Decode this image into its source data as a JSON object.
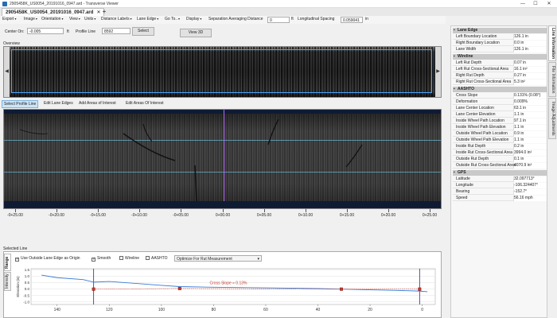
{
  "window": {
    "title": "2905458K_US0054_20191016_0947.ard - Transverse Viewer",
    "controls": [
      "—",
      "☐",
      "✕"
    ]
  },
  "tabs": [
    {
      "label": "2905458K_US0054_20191016_0947.ard",
      "close": "✕"
    }
  ],
  "tab_add": "+",
  "menu": {
    "items": [
      "Export",
      "Image",
      "Orientation",
      "View",
      "Units",
      "Distance Labels",
      "Lane Edge",
      "Go To..",
      "Display"
    ],
    "sep_avg_label": "Separation Averaging Distance",
    "sep_avg_value": "0",
    "sep_avg_unit": "ft",
    "long_spacing_label": "Longitudinal Spacing",
    "long_spacing_value": "0.059041",
    "long_spacing_unit": "in"
  },
  "center_bar": {
    "center_on_label": "Center On:",
    "center_on_value": "-0.005",
    "center_on_unit": "ft",
    "profile_line_label": "Profile Line",
    "profile_line_value": "8592",
    "select_label": "Select",
    "view3d_label": "View 3D"
  },
  "overview_label": "Overview",
  "edit_toolbar": [
    "Select Profile Line",
    "Edit Lane Edges",
    "Add Areas of Interest",
    "Edit Areas Of Interest"
  ],
  "ruler_labels": [
    "-0+25.00",
    "-0+20.00",
    "-0+15.00",
    "-0+10.00",
    "-0+05.00",
    "0+00.00",
    "0+05.00",
    "0+10.00",
    "0+15.00",
    "0+20.00",
    "0+25.00"
  ],
  "selected_line_label": "Selected Line",
  "bottom_tabs": [
    "Range",
    "Intensity"
  ],
  "options": {
    "use_outside": "Use Outside Lane Edge as Origin",
    "smooth": "Smooth",
    "wireline": "Wireline",
    "aashto": "AASHTO",
    "optimize": "Optimize For Rut Measurement"
  },
  "profile_chart": {
    "ylabel": "Elevation (in)",
    "annotation": "Cross Slope ≈ 0.13%"
  },
  "chart_data": {
    "type": "line",
    "xlabel": "",
    "ylabel": "Elevation (in)",
    "x_ticks": [
      140,
      120,
      100,
      80,
      60,
      40,
      20,
      0
    ],
    "y_ticks": [
      "1.5",
      "1.0",
      "0.5",
      "0.0",
      "-0.5",
      "-1.0"
    ],
    "xlim": [
      150,
      -5
    ],
    "ylim": [
      -1.2,
      1.6
    ],
    "annotation": "Cross Slope ≈ 0.13%",
    "series": [
      {
        "x": [
          146,
          140,
          130,
          126,
          120,
          110,
          100,
          93,
          80,
          60,
          40,
          31,
          20,
          10,
          1,
          -2
        ],
        "y": [
          1.1,
          0.9,
          0.75,
          0.55,
          0.6,
          0.45,
          0.3,
          0.2,
          0.15,
          0.1,
          0.05,
          0.0,
          -0.05,
          -0.1,
          -0.15,
          -0.2
        ]
      },
      {
        "x": [
          126,
          93,
          31,
          1
        ],
        "y": [
          0.0,
          0.05,
          0.0,
          0.0
        ]
      }
    ]
  },
  "right_panel": {
    "sections": [
      {
        "title": "Lane Edge",
        "rows": [
          [
            "Left Boundary Location",
            "126.1 in"
          ],
          [
            "Right Boundary Location",
            "0.0 in"
          ],
          [
            "Lane Width",
            "126.1 in"
          ]
        ]
      },
      {
        "title": "Wireline",
        "rows": [
          [
            "Left Rut Depth",
            "0.07 in"
          ],
          [
            "Left Rut Cross-Sectional Area",
            "16.1 in²"
          ],
          [
            "Right Rut Depth",
            "0.27 in"
          ],
          [
            "Right Rut Cross-Sectional Area",
            "5.3 in²"
          ]
        ]
      },
      {
        "title": "AASHTO",
        "rows": [
          [
            "Cross Slope",
            "0.131% (0.08°)"
          ],
          [
            "Deformation",
            "0.009%"
          ],
          [
            "Lane Center Location",
            "63.1 in"
          ],
          [
            "Lane Center Elevation",
            "1.1 in"
          ],
          [
            "Inside Wheel Path Location",
            "97.1 in"
          ],
          [
            "Inside Wheel Path Elevation",
            "1.1 in"
          ],
          [
            "Outside Wheel Path Location",
            "0.9 in"
          ],
          [
            "Outside Wheel Path Elevation",
            "1.1 in"
          ],
          [
            "Inside Rut Depth",
            "0.2 in"
          ],
          [
            "Inside Rut Cross-Sectional Area",
            "3994.0 in²"
          ],
          [
            "Outside Rut Depth",
            "0.1 in"
          ],
          [
            "Outside Rut Cross-Sectional Area",
            "4070.9 in²"
          ]
        ]
      },
      {
        "title": "GPS",
        "rows": [
          [
            "Latitude",
            "32.097713°"
          ],
          [
            "Longitude",
            "-106.324407°"
          ],
          [
            "Bearing",
            "-152.7°"
          ],
          [
            "Speed",
            "56.16 mph"
          ]
        ]
      }
    ]
  },
  "right_tabs": [
    "Line Information",
    "File Information",
    "Image Adjustments"
  ]
}
